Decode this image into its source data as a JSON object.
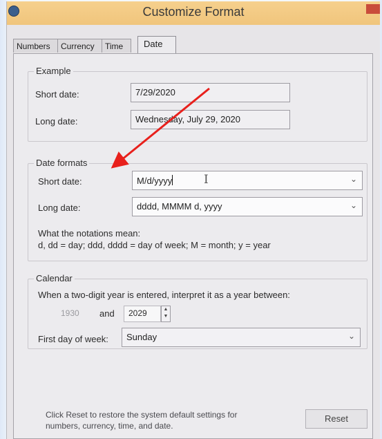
{
  "window": {
    "title": "Customize Format"
  },
  "tabs": [
    {
      "label": "Numbers"
    },
    {
      "label": "Currency"
    },
    {
      "label": "Time"
    },
    {
      "label": "Date"
    }
  ],
  "example": {
    "legend": "Example",
    "short_label": "Short date:",
    "short_value": "7/29/2020",
    "long_label": "Long date:",
    "long_value": "Wednesday, July 29, 2020"
  },
  "formats": {
    "legend": "Date formats",
    "short_label": "Short date:",
    "short_value": "M/d/yyyy",
    "long_label": "Long date:",
    "long_value": "dddd, MMMM d, yyyy",
    "notes_title": "What the notations mean:",
    "notes_text": "d, dd = day;  ddd, dddd = day of week;  M = month;  y = year"
  },
  "calendar": {
    "legend": "Calendar",
    "two_digit_text": "When a two-digit year is entered, interpret it as a year between:",
    "year_from": "1930",
    "and_label": "and",
    "year_to": "2029",
    "first_day_label": "First day of week:",
    "first_day_value": "Sunday"
  },
  "footer": {
    "reset_text_line1": "Click Reset to restore the system default settings for",
    "reset_text_line2": "numbers, currency, time, and date.",
    "reset_button": "Reset"
  },
  "colors": {
    "arrow": "#e8201c",
    "titlebar": "#f0c57c"
  }
}
